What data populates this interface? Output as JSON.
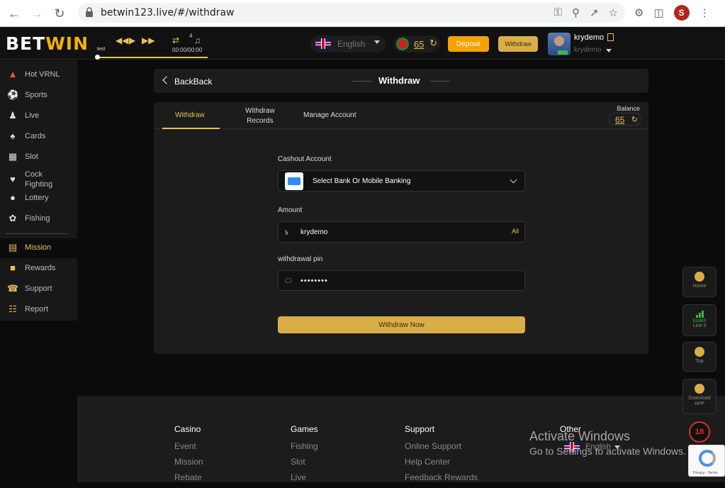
{
  "browser": {
    "url": "betwin123.live/#/withdraw",
    "profile_initial": "S"
  },
  "header": {
    "logo_prefix": "BET",
    "logo_accent": "WIN",
    "player": {
      "track": "test",
      "time": "00:00/00:00",
      "count": "4"
    },
    "language": "English",
    "balance": "65",
    "deposit_label": "Deposit",
    "withdraw_label": "Withdraw",
    "username": "krydemo",
    "user_sub": "krydemo"
  },
  "sidebar": {
    "items": [
      {
        "label": "Hot VRNL",
        "icon": "fire-icon"
      },
      {
        "label": "Sports",
        "icon": "soccer-ball-icon"
      },
      {
        "label": "Live",
        "icon": "live-dealer-icon"
      },
      {
        "label": "Cards",
        "icon": "cards-icon"
      },
      {
        "label": "Slot",
        "icon": "slot-machine-icon"
      },
      {
        "label": "Cock Fighting",
        "icon": "rooster-icon"
      },
      {
        "label": "Lottery",
        "icon": "lottery-icon"
      },
      {
        "label": "Fishing",
        "icon": "fish-icon"
      },
      {
        "label": "Mission",
        "icon": "mission-icon"
      },
      {
        "label": "Rewards",
        "icon": "gift-icon"
      },
      {
        "label": "Support",
        "icon": "headset-icon"
      },
      {
        "label": "Report",
        "icon": "report-icon"
      }
    ],
    "active": "Mission"
  },
  "page": {
    "back_label": "BackBack",
    "title": "Withdraw"
  },
  "tabs": {
    "withdraw": "Withdraw",
    "records_line1": "Withdraw",
    "records_line2": "Records",
    "manage": "Manage Account",
    "balance_label": "Balance",
    "balance_value": "65"
  },
  "form": {
    "cashout_label": "Cashout Account",
    "cashout_value": "Select Bank Or Mobile Banking",
    "amount_label": "Amount",
    "currency_symbol": "৳",
    "amount_value": "krydemo",
    "all_label": "All",
    "pin_label": "withdrawal pin",
    "pin_value": "••••••••",
    "submit_label": "Withdraw Now"
  },
  "floating": {
    "home": "Home",
    "latency": "516MS",
    "line": "Line 5",
    "top": "Top",
    "download_line1": "Download",
    "download_line2": "APP",
    "age": "18"
  },
  "footer": {
    "columns": [
      {
        "head": "Casino",
        "links": [
          "Event",
          "Mission",
          "Rebate"
        ]
      },
      {
        "head": "Games",
        "links": [
          "Fishing",
          "Slot",
          "Live"
        ]
      },
      {
        "head": "Support",
        "links": [
          "Online Support",
          "Help Center",
          "Feedback Rewards"
        ]
      },
      {
        "head": "Other",
        "links": []
      }
    ],
    "language": "English"
  },
  "overlay": {
    "activate_title": "Activate Windows",
    "activate_sub": "Go to Settings to activate Windows.",
    "recaptcha_text": "Privacy - Terms"
  },
  "colors": {
    "accent_gold": "#d9ae49",
    "deposit_orange": "#f5a300",
    "background": "#0b0b0b"
  }
}
